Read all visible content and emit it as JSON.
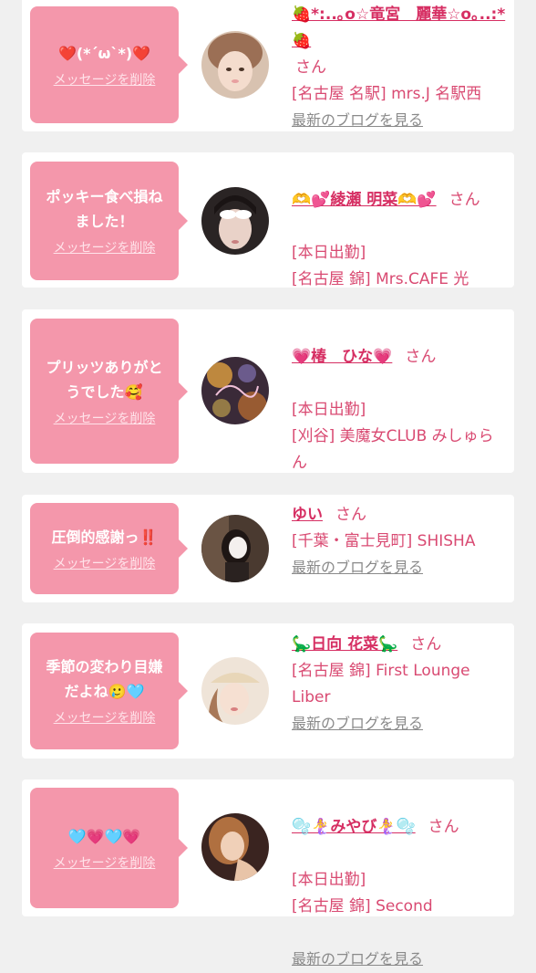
{
  "delete_label": "メッセージを削除",
  "blog_label": "最新のブログを見る",
  "san_label": "さん",
  "colors": {
    "bubble": "#f497ab",
    "name": "#d62f63",
    "text": "#d94a72",
    "link": "#8a8a8a",
    "background": "#f0f0f0"
  },
  "cards": [
    {
      "message": "❤️(*´ω`*)❤️",
      "name": "🍓*:..｡o☆竜宮　麗華☆o｡..:*🍓",
      "detail": "[名古屋 名駅] mrs.J 名駅西"
    },
    {
      "message": "ポッキー食べ損ね\nました！",
      "name": "🫶💕綾瀬 明菜🫶💕",
      "detail": "[本日出勤]\n[名古屋 錦] Mrs.CAFE 光"
    },
    {
      "message": "プリッツありがと\nうでした🥰",
      "name": "💗椿　ひな💗",
      "detail": "[本日出勤]\n[刈谷] 美魔女CLUB みしゅらん"
    },
    {
      "message": "圧倒的感謝っ‼️",
      "name": "ゆい",
      "detail": "[千葉・富士見町] SHISHA"
    },
    {
      "message": "季節の変わり目嫌\nだよね🥲🩵",
      "name": "🦕日向 花菜🦕",
      "detail": "[名古屋 錦] First Lounge Liber"
    },
    {
      "message": "🩵💗🩵💗",
      "name": "🫧🧜‍♀️みやび🧜‍♀️🫧",
      "detail": "[本日出勤]\n[名古屋 錦] Second"
    }
  ]
}
